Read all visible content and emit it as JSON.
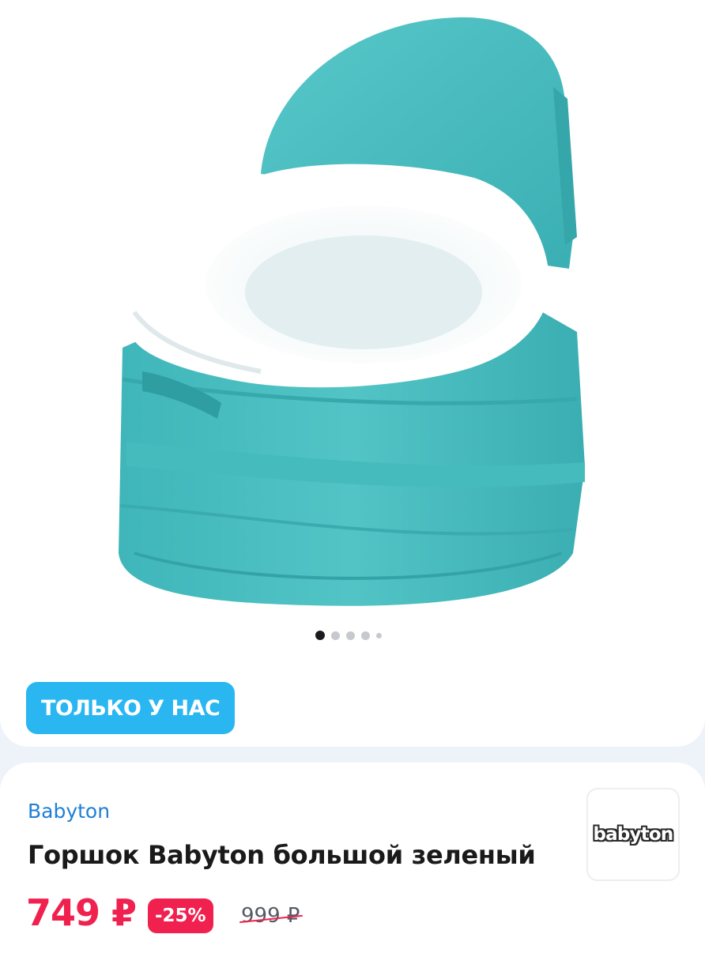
{
  "gallery": {
    "image_alt": "Горшок Babyton большой зеленый",
    "dots": {
      "count": 5,
      "active": 0
    }
  },
  "promo": {
    "label": "ТОЛЬКО У НАС"
  },
  "product": {
    "brand": "Babyton",
    "title": "Горшок Babyton большой зеленый",
    "brand_logo_text": "babyton",
    "price": "749 ₽",
    "discount": "-25%",
    "old_price": "999 ₽"
  },
  "colors": {
    "accent_blue": "#29b6f1",
    "price_red": "#f0214f",
    "brand_link": "#1f7fd6",
    "potty_teal": "#4dbfc2"
  }
}
